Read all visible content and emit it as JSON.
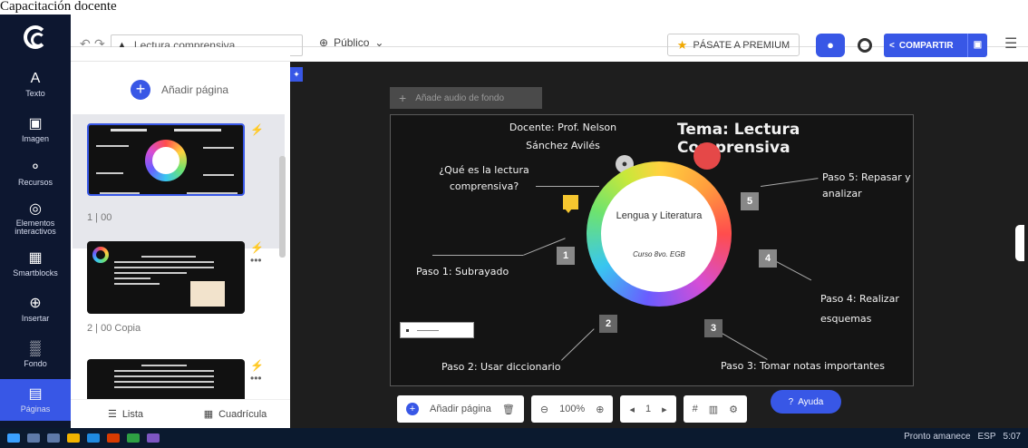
{
  "caption": "Capacitación docente",
  "toolbar": {
    "undo_icon": "undo-icon",
    "redo_icon": "redo-icon",
    "title_value": "Lectura comprensiva",
    "visibility": "Público",
    "premium_label": "PÁSATE A PREMIUM",
    "share_label": "COMPARTIR"
  },
  "sidebar": {
    "items": [
      {
        "icon": "A",
        "label": "Texto"
      },
      {
        "icon": "▣",
        "label": "Imagen"
      },
      {
        "icon": "⚬",
        "label": "Recursos"
      },
      {
        "icon": "◎",
        "label": "Elementos interactivos"
      },
      {
        "icon": "▦",
        "label": "Smartblocks"
      },
      {
        "icon": "⊕",
        "label": "Insertar"
      },
      {
        "icon": "▒",
        "label": "Fondo"
      },
      {
        "icon": "▤",
        "label": "Páginas"
      }
    ]
  },
  "pages_panel": {
    "add_page_label": "Añadir página",
    "thumbs": [
      {
        "label": "1 | 00"
      },
      {
        "label": "2 | 00 Copia"
      }
    ],
    "bottom": {
      "list_label": "Lista",
      "grid_label": "Cuadrícula"
    }
  },
  "canvas": {
    "audio_label": "Añade audio de fondo",
    "slide": {
      "docente": "Docente: Prof. Nelson Sánchez Avilés",
      "tema": "Tema: Lectura Comprensiva",
      "question": "¿Qué es la lectura comprensiva?",
      "center_title": "Lengua y Literatura",
      "center_sub": "Curso 8vo. EGB",
      "steps": [
        {
          "n": "1",
          "text": "Paso 1: Subrayado"
        },
        {
          "n": "2",
          "text": "Paso 2: Usar diccionario"
        },
        {
          "n": "3",
          "text": "Paso 3: Tomar notas importantes"
        },
        {
          "n": "4",
          "text": "Paso 4: Realizar esquemas"
        },
        {
          "n": "5",
          "text": "Paso 5: Repasar y analizar"
        }
      ]
    }
  },
  "bottombar": {
    "add_page_label": "Añadir página",
    "zoom": "100%",
    "page_num": "1"
  },
  "help_label": "Ayuda",
  "taskbar": {
    "weather": "Pronto amanece",
    "lang": "ESP",
    "time": "5:07"
  }
}
